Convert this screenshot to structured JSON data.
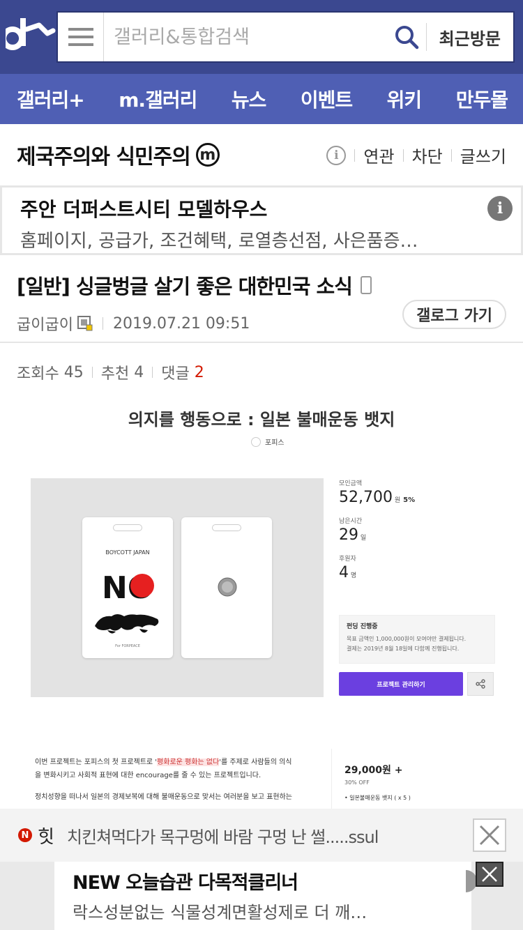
{
  "header": {
    "search_placeholder": "갤러리&통합검색",
    "recent_label": "최근방문"
  },
  "nav": {
    "items": [
      "갤러리+",
      "m.갤러리",
      "뉴스",
      "이벤트",
      "위키",
      "만두몰"
    ]
  },
  "gallery": {
    "title": "제국주의와 식민주의",
    "badge": "m",
    "actions": [
      "연관",
      "차단",
      "글쓰기"
    ]
  },
  "ad": {
    "title": "주안 더퍼스트시티 모델하우스",
    "desc": "홈페이지, 공급가, 조건혜택, 로열층선점, 사은품증…"
  },
  "post": {
    "title": "[일반] 싱글벙글 살기 좋은 대한민국 소식",
    "author": "굽이굽이",
    "date": "2019.07.21 09:51",
    "back_label": "갤로그 가기",
    "views_label": "조회수",
    "views": "45",
    "likes_label": "추천",
    "likes": "4",
    "comments_label": "댓글",
    "comments": "2"
  },
  "embedded": {
    "title": "의지를 행동으로 : 일본 불매운동 뱃지",
    "brand": "포피스",
    "card_text": "BOYCOTT JAPAN",
    "card_no": "NO",
    "card_footer": "For FORPEACE",
    "raised_label": "모인금액",
    "raised_value": "52,700",
    "raised_unit": "원",
    "raised_pct": "5%",
    "remaining_label": "남은시간",
    "remaining_value": "29",
    "remaining_unit": "일",
    "backers_label": "후원자",
    "backers_value": "4",
    "backers_unit": "명",
    "funding_title": "펀딩 진행중",
    "funding_line1": "목표 금액인 1,000,000원이 모여야만 결제됩니다.",
    "funding_line2": "결제는 2019년 8월 18일에 다함께 진행됩니다.",
    "manage_btn": "프로젝트 관리하기",
    "body_line1_a": "이번 프로젝트는 포피스의 첫 프로젝트로 '",
    "body_line1_hl": "평화로운 평화는 없다",
    "body_line1_b": "'를 주제로 사람들의 의식",
    "body_line2": "을 변화시키고 사회적 표현에 대한 encourage를 줄 수 있는 프로젝트입니다.",
    "body_line3": "정치성향을 떠나서 일본의 경제보복에 대해 불매운동으로 맞서는 여러분을 보고 표현하는",
    "side_price": "29,000원 +",
    "side_off": "30% OFF",
    "side_item": "• 일본불매운동 뱃지 ( x 5 )"
  },
  "hit": {
    "badge": "N",
    "label": "힛",
    "text": "치킨쳐먹다가 목구멍에 바람 구멍 난 썰.....ssul"
  },
  "bottom_ad": {
    "title": "NEW 오늘습관 다목적클리너",
    "desc": "락스성분없는 식물성계면활성제로 더 깨…"
  },
  "colors": {
    "topbar": "#3b4890",
    "nav": "#4f5fb4",
    "accent_red": "#d31900",
    "project_purple": "#6b3fe0"
  }
}
